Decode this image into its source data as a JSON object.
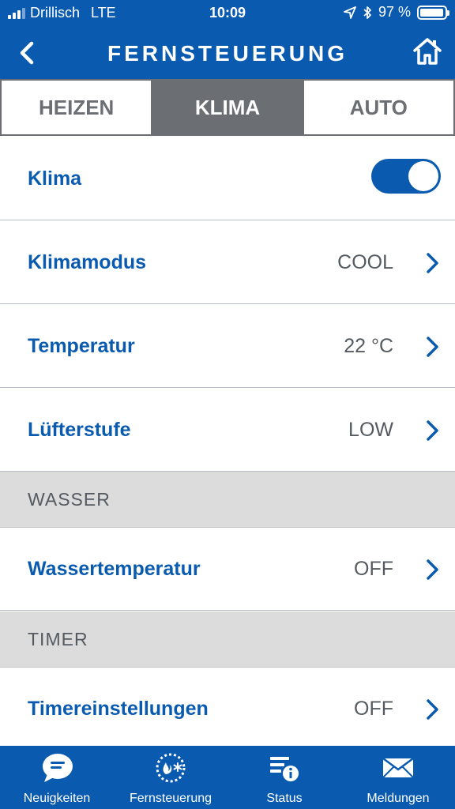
{
  "status_bar": {
    "carrier": "Drillisch",
    "network": "LTE",
    "time": "10:09",
    "battery": "97 %",
    "battery_level": 0.97
  },
  "nav": {
    "title": "FERNSTEUERUNG",
    "back_icon": "chevron-left-icon",
    "home_icon": "home-icon"
  },
  "tabs": [
    {
      "label": "HEIZEN",
      "active": false
    },
    {
      "label": "KLIMA",
      "active": true
    },
    {
      "label": "AUTO",
      "active": false
    }
  ],
  "klima": {
    "label": "Klima",
    "enabled": true
  },
  "rows": [
    {
      "label": "Klimamodus",
      "value": "COOL"
    },
    {
      "label": "Temperatur",
      "value": "22 °C"
    },
    {
      "label": "Lüfterstufe",
      "value": "LOW"
    }
  ],
  "sections": [
    {
      "title": "WASSER",
      "row": {
        "label": "Wassertemperatur",
        "value": "OFF"
      }
    },
    {
      "title": "TIMER",
      "row": {
        "label": "Timereinstellungen",
        "value": "OFF"
      }
    }
  ],
  "tab_bar": [
    {
      "label": "Neuigkeiten",
      "icon": "speech-bubble-icon"
    },
    {
      "label": "Fernsteuerung",
      "icon": "remote-control-icon"
    },
    {
      "label": "Status",
      "icon": "status-info-icon"
    },
    {
      "label": "Meldungen",
      "icon": "envelope-icon"
    }
  ],
  "colors": {
    "brand_blue": "#0a5bb0",
    "tab_active_gray": "#6b6e73",
    "section_gray": "#dcdcdc"
  }
}
